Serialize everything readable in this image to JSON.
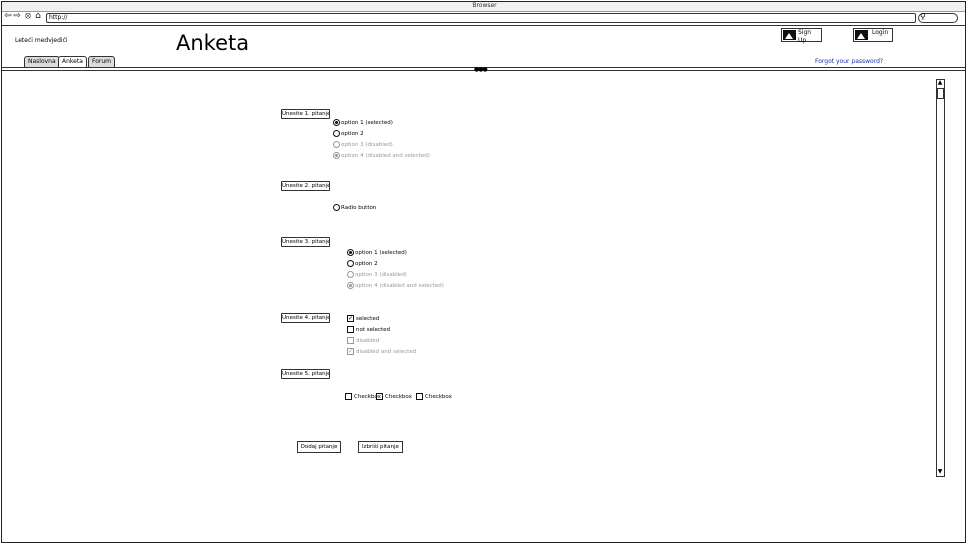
{
  "browser": {
    "title": "Browser",
    "url": "http://"
  },
  "header": {
    "brand": "Leteći medvjedići",
    "page_title": "Anketa",
    "signup_label": "Sign Up",
    "login_label": "Login",
    "forgot_label": "Forgot your password?"
  },
  "tabs": [
    {
      "label": "Naslovna"
    },
    {
      "label": "Anketa"
    },
    {
      "label": "Forum"
    }
  ],
  "questions": [
    {
      "label": "Unesite 1. pitanje",
      "options": [
        {
          "label": "option 1 (selected)"
        },
        {
          "label": "option 2"
        },
        {
          "label": "option 3 (disabled)"
        },
        {
          "label": "option 4 (disabled and selected)"
        }
      ]
    },
    {
      "label": "Unesite 2. pitanje",
      "options": [
        {
          "label": "Radio button"
        }
      ]
    },
    {
      "label": "Unesite 3. pitanje",
      "options": [
        {
          "label": "option 1 (selected)"
        },
        {
          "label": "option 2"
        },
        {
          "label": "option 3 (disabled)"
        },
        {
          "label": "option 4 (disabled and selected)"
        }
      ]
    },
    {
      "label": "Unesite 4. pitanje",
      "options": [
        {
          "label": "selected"
        },
        {
          "label": "not selected"
        },
        {
          "label": "disabled"
        },
        {
          "label": "disabled and selected"
        }
      ]
    },
    {
      "label": "Unesite 5. pitanje",
      "options": [
        {
          "label": "Checkbox"
        },
        {
          "label": "Checkbox"
        },
        {
          "label": "Checkbox"
        }
      ]
    }
  ],
  "actions": {
    "add_label": "Dodaj pitanje",
    "delete_label": "Izbriši pitanje"
  }
}
